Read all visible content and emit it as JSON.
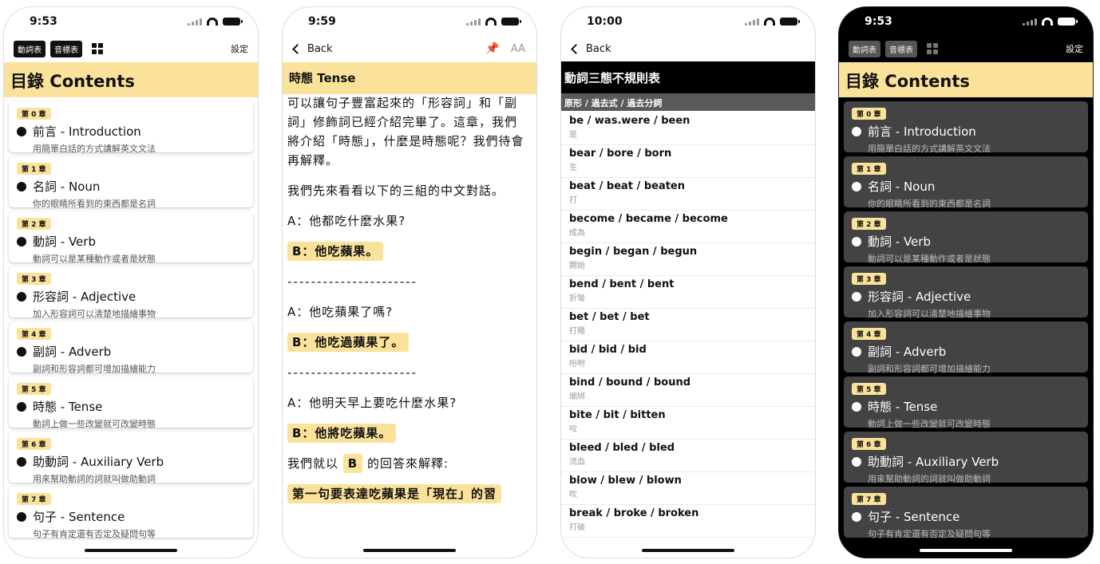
{
  "screens": [
    {
      "time": "9:53",
      "toolbar": {
        "verb_table": "動詞表",
        "phonetic_table": "音標表",
        "settings": "設定"
      },
      "header": "目錄 Contents",
      "chapters": [
        {
          "badge": "第 0 章",
          "title": "前言 - Introduction",
          "subtitle": "用簡單白話的方式講解英文文法"
        },
        {
          "badge": "第 1 章",
          "title": "名詞 - Noun",
          "subtitle": "你的眼睛所看到的東西都是名詞"
        },
        {
          "badge": "第 2 章",
          "title": "動詞 - Verb",
          "subtitle": "動詞可以是某種動作或者是狀態"
        },
        {
          "badge": "第 3 章",
          "title": "形容詞 - Adjective",
          "subtitle": "加入形容詞可以清楚地描繪事物"
        },
        {
          "badge": "第 4 章",
          "title": "副詞 - Adverb",
          "subtitle": "副詞和形容詞都可增加描繪能力"
        },
        {
          "badge": "第 5 章",
          "title": "時態 - Tense",
          "subtitle": "動詞上做一些改變就可改變時態"
        },
        {
          "badge": "第 6 章",
          "title": "助動詞 - Auxiliary Verb",
          "subtitle": "用來幫助動詞的詞就叫做助動詞"
        },
        {
          "badge": "第 7 章",
          "title": "句子 - Sentence",
          "subtitle": "句子有肯定還有否定及疑問句等"
        }
      ]
    },
    {
      "time": "9:59",
      "back": "Back",
      "font_button": "AA",
      "header": "時態 Tense",
      "paragraphs": [
        "可以讓句子豐富起來的「形容詞」和「副詞」修飾詞已經介紹完畢了。這章，我們將介紹「時態」，什麼是時態呢？我們待會再解釋。",
        "我們先來看看以下的三組的中文對話。"
      ],
      "dialog": [
        {
          "a": "A：他都吃什麼水果?",
          "b": "B：他吃蘋果。"
        },
        {
          "a": "A：他吃蘋果了嗎?",
          "b": "B：他吃過蘋果了。"
        },
        {
          "a": "A：他明天早上要吃什麼水果?",
          "b": "B：他將吃蘋果。"
        }
      ],
      "divider": "----------------------",
      "explain_prefix": "我們就以",
      "explain_hl": "B",
      "explain_suffix": "的回答來解釋:",
      "last_line": "第一句要表達吃蘋果是「現在」的習"
    },
    {
      "time": "10:00",
      "back": "Back",
      "header": "動詞三態不規則表",
      "subheader": "原形 / 過去式 / 過去分詞",
      "verbs": [
        {
          "forms": "be / was.were / been",
          "meaning": "是"
        },
        {
          "forms": "bear / bore / born",
          "meaning": "生"
        },
        {
          "forms": "beat / beat / beaten",
          "meaning": "打"
        },
        {
          "forms": "become / became / become",
          "meaning": "成為"
        },
        {
          "forms": "begin / began / begun",
          "meaning": "開始"
        },
        {
          "forms": "bend / bent / bent",
          "meaning": "折彎"
        },
        {
          "forms": "bet / bet / bet",
          "meaning": "打賭"
        },
        {
          "forms": "bid / bid / bid",
          "meaning": "吩咐"
        },
        {
          "forms": "bind / bound / bound",
          "meaning": "綑綁"
        },
        {
          "forms": "bite / bit / bitten",
          "meaning": "咬"
        },
        {
          "forms": "bleed / bled / bled",
          "meaning": "流血"
        },
        {
          "forms": "blow / blew / blown",
          "meaning": "吹"
        },
        {
          "forms": "break / broke / broken",
          "meaning": "打破"
        }
      ]
    },
    {
      "time": "9:53",
      "toolbar": {
        "verb_table": "動詞表",
        "phonetic_table": "音標表",
        "settings": "設定"
      },
      "header": "目錄 Contents"
    }
  ],
  "colors": {
    "accent": "#fbe29b",
    "dark_card": "#434343"
  }
}
